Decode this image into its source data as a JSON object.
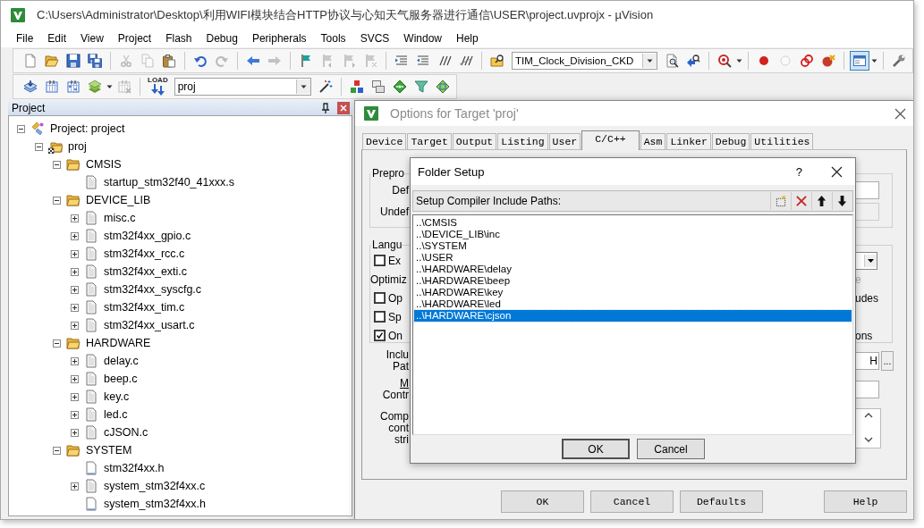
{
  "window": {
    "title": "C:\\Users\\Administrator\\Desktop\\利用WIFI模块结合HTTP协议与心知天气服务器进行通信\\USER\\project.uvprojx - µVision"
  },
  "menu": [
    "File",
    "Edit",
    "View",
    "Project",
    "Flash",
    "Debug",
    "Peripherals",
    "Tools",
    "SVCS",
    "Window",
    "Help"
  ],
  "toolbars": [
    [
      {
        "kind": "new",
        "disabled": false,
        "pressed": false
      },
      {
        "kind": "open",
        "disabled": false,
        "pressed": false
      },
      {
        "kind": "save",
        "disabled": false,
        "pressed": false
      },
      {
        "kind": "save_all",
        "disabled": false,
        "pressed": false
      },
      {
        "kind": "sep"
      },
      {
        "kind": "cut",
        "disabled": true,
        "pressed": false
      },
      {
        "kind": "copy",
        "disabled": true,
        "pressed": false
      },
      {
        "kind": "paste",
        "disabled": false,
        "pressed": false
      },
      {
        "kind": "sep"
      },
      {
        "kind": "undo",
        "disabled": false,
        "pressed": false
      },
      {
        "kind": "redo",
        "disabled": true,
        "pressed": false
      },
      {
        "kind": "sep"
      },
      {
        "kind": "back",
        "disabled": false,
        "pressed": false
      },
      {
        "kind": "forward",
        "disabled": true,
        "pressed": false
      },
      {
        "kind": "sep"
      },
      {
        "kind": "bookmark",
        "disabled": false,
        "pressed": false
      },
      {
        "kind": "bookmark_prev",
        "disabled": true,
        "pressed": false
      },
      {
        "kind": "bookmark_next",
        "disabled": true,
        "pressed": false
      },
      {
        "kind": "bookmark_clear",
        "disabled": true,
        "pressed": false
      },
      {
        "kind": "sep"
      },
      {
        "kind": "indent",
        "disabled": false,
        "pressed": false
      },
      {
        "kind": "outdent",
        "disabled": false,
        "pressed": false
      },
      {
        "kind": "comment",
        "disabled": false,
        "pressed": false
      },
      {
        "kind": "uncomment",
        "disabled": false,
        "pressed": false
      },
      {
        "kind": "sep"
      },
      {
        "kind": "find_files",
        "disabled": false,
        "pressed": false
      },
      {
        "kind": "combo",
        "value": "TIM_Clock_Division_CKD"
      },
      {
        "kind": "find",
        "disabled": false,
        "pressed": false
      },
      {
        "kind": "incremental_find",
        "disabled": false,
        "pressed": false
      },
      {
        "kind": "sep"
      },
      {
        "kind": "debug",
        "disabled": false,
        "pressed": false,
        "menu": true
      },
      {
        "kind": "sep"
      },
      {
        "kind": "bp_insert",
        "disabled": false,
        "pressed": false
      },
      {
        "kind": "bp_enable",
        "disabled": true,
        "pressed": false
      },
      {
        "kind": "bp_disable_all",
        "disabled": false,
        "pressed": false
      },
      {
        "kind": "bp_kill",
        "disabled": false,
        "pressed": false
      },
      {
        "kind": "sep"
      },
      {
        "kind": "windows",
        "disabled": false,
        "pressed": true,
        "menu": true
      },
      {
        "kind": "sep"
      },
      {
        "kind": "config",
        "disabled": false,
        "pressed": false
      }
    ],
    [
      {
        "kind": "translate",
        "disabled": false,
        "pressed": false
      },
      {
        "kind": "build",
        "disabled": false,
        "pressed": false
      },
      {
        "kind": "rebuild",
        "disabled": false,
        "pressed": false
      },
      {
        "kind": "batch",
        "disabled": false,
        "pressed": false,
        "menu": true
      },
      {
        "kind": "stop",
        "disabled": true,
        "pressed": false
      },
      {
        "kind": "sep"
      },
      {
        "kind": "download",
        "label": "LOAD",
        "disabled": false,
        "pressed": false
      },
      {
        "kind": "combo",
        "value": "proj"
      },
      {
        "kind": "options",
        "disabled": false,
        "pressed": false
      },
      {
        "kind": "sep"
      },
      {
        "kind": "components",
        "disabled": false,
        "pressed": false
      },
      {
        "kind": "env",
        "disabled": false,
        "pressed": false
      },
      {
        "kind": "diamond",
        "disabled": false,
        "pressed": false
      },
      {
        "kind": "funnel",
        "disabled": false,
        "pressed": false
      },
      {
        "kind": "pack",
        "disabled": false,
        "pressed": false
      }
    ]
  ],
  "project_panel": {
    "title": "Project",
    "tree": [
      {
        "label": "Project: project",
        "kind": "project",
        "expanded": true,
        "children": [
          {
            "label": "proj",
            "kind": "target",
            "expanded": true,
            "children": [
              {
                "label": "CMSIS",
                "kind": "folder",
                "expanded": true,
                "children": [
                  {
                    "label": "startup_stm32f40_41xxx.s",
                    "kind": "file"
                  }
                ]
              },
              {
                "label": "DEVICE_LIB",
                "kind": "folder",
                "expanded": true,
                "children": [
                  {
                    "label": "misc.c",
                    "kind": "file",
                    "expanded": false
                  },
                  {
                    "label": "stm32f4xx_gpio.c",
                    "kind": "file",
                    "expanded": false
                  },
                  {
                    "label": "stm32f4xx_rcc.c",
                    "kind": "file",
                    "expanded": false
                  },
                  {
                    "label": "stm32f4xx_exti.c",
                    "kind": "file",
                    "expanded": false
                  },
                  {
                    "label": "stm32f4xx_syscfg.c",
                    "kind": "file",
                    "expanded": false
                  },
                  {
                    "label": "stm32f4xx_tim.c",
                    "kind": "file",
                    "expanded": false
                  },
                  {
                    "label": "stm32f4xx_usart.c",
                    "kind": "file",
                    "expanded": false
                  }
                ]
              },
              {
                "label": "HARDWARE",
                "kind": "folder",
                "expanded": true,
                "children": [
                  {
                    "label": "delay.c",
                    "kind": "file",
                    "expanded": false
                  },
                  {
                    "label": "beep.c",
                    "kind": "file",
                    "expanded": false
                  },
                  {
                    "label": "key.c",
                    "kind": "file",
                    "expanded": false
                  },
                  {
                    "label": "led.c",
                    "kind": "file",
                    "expanded": false
                  },
                  {
                    "label": "cJSON.c",
                    "kind": "file",
                    "expanded": false
                  }
                ]
              },
              {
                "label": "SYSTEM",
                "kind": "folder",
                "expanded": true,
                "children": [
                  {
                    "label": "stm32f4xx.h",
                    "kind": "header"
                  },
                  {
                    "label": "system_stm32f4xx.c",
                    "kind": "file",
                    "expanded": false
                  },
                  {
                    "label": "system_stm32f4xx.h",
                    "kind": "header"
                  }
                ]
              }
            ]
          }
        ]
      }
    ]
  },
  "options_dialog": {
    "title": "Options for Target 'proj'",
    "tabs": [
      {
        "label": "Device",
        "selected": false
      },
      {
        "label": "Target",
        "selected": false
      },
      {
        "label": "Output",
        "selected": false
      },
      {
        "label": "Listing",
        "selected": false
      },
      {
        "label": "User",
        "selected": false
      },
      {
        "label": "C/C++",
        "selected": true
      },
      {
        "label": "Asm",
        "selected": false
      },
      {
        "label": "Linker",
        "selected": false
      },
      {
        "label": "Debug",
        "selected": false
      },
      {
        "label": "Utilities",
        "selected": false
      }
    ],
    "preprocessor": {
      "legend": "Prepro",
      "rows": [
        "Def",
        "Undef"
      ]
    },
    "language": {
      "legend": "Langu",
      "rows": [
        {
          "kind": "combo",
          "label": "Ex",
          "checked": false
        },
        {
          "kind": "label",
          "label": "Optimiz",
          "right_text": "e",
          "right_disabled": true
        },
        {
          "kind": "checkbox",
          "label": "Op",
          "checked": false,
          "right_text": "udes",
          "right_disabled": false
        },
        {
          "kind": "checkbox",
          "label": "Sp",
          "checked": false
        },
        {
          "kind": "checkbox",
          "label": "On",
          "checked": true,
          "right_text": "ons",
          "right_disabled": false
        }
      ]
    },
    "include": {
      "label_lines": [
        "Inclu",
        "Pat"
      ],
      "value": "H",
      "button": "..."
    },
    "misc": {
      "label_lines": [
        "M",
        "Contr"
      ]
    },
    "compiler": {
      "label_lines": [
        "Comp",
        "cont",
        "stri"
      ]
    },
    "buttons": [
      "OK",
      "Cancel",
      "Defaults",
      "Help"
    ]
  },
  "folder_setup": {
    "title": "Folder Setup",
    "help": "?",
    "header": "Setup Compiler Include Paths:",
    "paths": [
      {
        "text": "..\\CMSIS",
        "selected": false
      },
      {
        "text": "..\\DEVICE_LIB\\inc",
        "selected": false
      },
      {
        "text": "..\\SYSTEM",
        "selected": false
      },
      {
        "text": "..\\USER",
        "selected": false
      },
      {
        "text": "..\\HARDWARE\\delay",
        "selected": false
      },
      {
        "text": "..\\HARDWARE\\beep",
        "selected": false
      },
      {
        "text": "..\\HARDWARE\\key",
        "selected": false
      },
      {
        "text": "..\\HARDWARE\\led",
        "selected": false
      },
      {
        "text": "..\\HARDWARE\\cjson",
        "selected": true
      }
    ],
    "buttons": [
      "OK",
      "Cancel"
    ]
  }
}
